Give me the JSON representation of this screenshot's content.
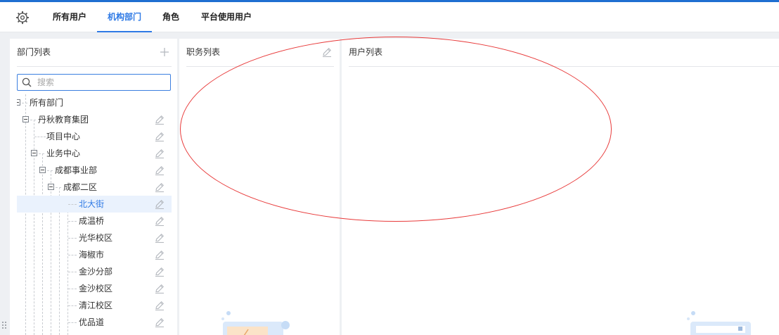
{
  "nav": {
    "tabs": [
      {
        "label": "所有用户"
      },
      {
        "label": "机构部门"
      },
      {
        "label": "角色"
      },
      {
        "label": "平台使用用户"
      }
    ]
  },
  "dept_panel": {
    "title": "部门列表",
    "search_placeholder": "搜索",
    "tree": [
      {
        "label": "所有部门"
      },
      {
        "label": "丹秋教育集团"
      },
      {
        "label": "项目中心"
      },
      {
        "label": "业务中心"
      },
      {
        "label": "成都事业部"
      },
      {
        "label": "成都二区"
      },
      {
        "label": "北大街"
      },
      {
        "label": "成温桥"
      },
      {
        "label": "光华校区"
      },
      {
        "label": "海椒市"
      },
      {
        "label": "金沙分部"
      },
      {
        "label": "金沙校区"
      },
      {
        "label": "清江校区"
      },
      {
        "label": "优品道"
      }
    ]
  },
  "position_panel": {
    "title": "职务列表"
  },
  "user_panel": {
    "title": "用户列表"
  },
  "colors": {
    "accent": "#2f7ae5",
    "annotation": "#e83a3a",
    "top_stripe": "#1f6fd1"
  }
}
